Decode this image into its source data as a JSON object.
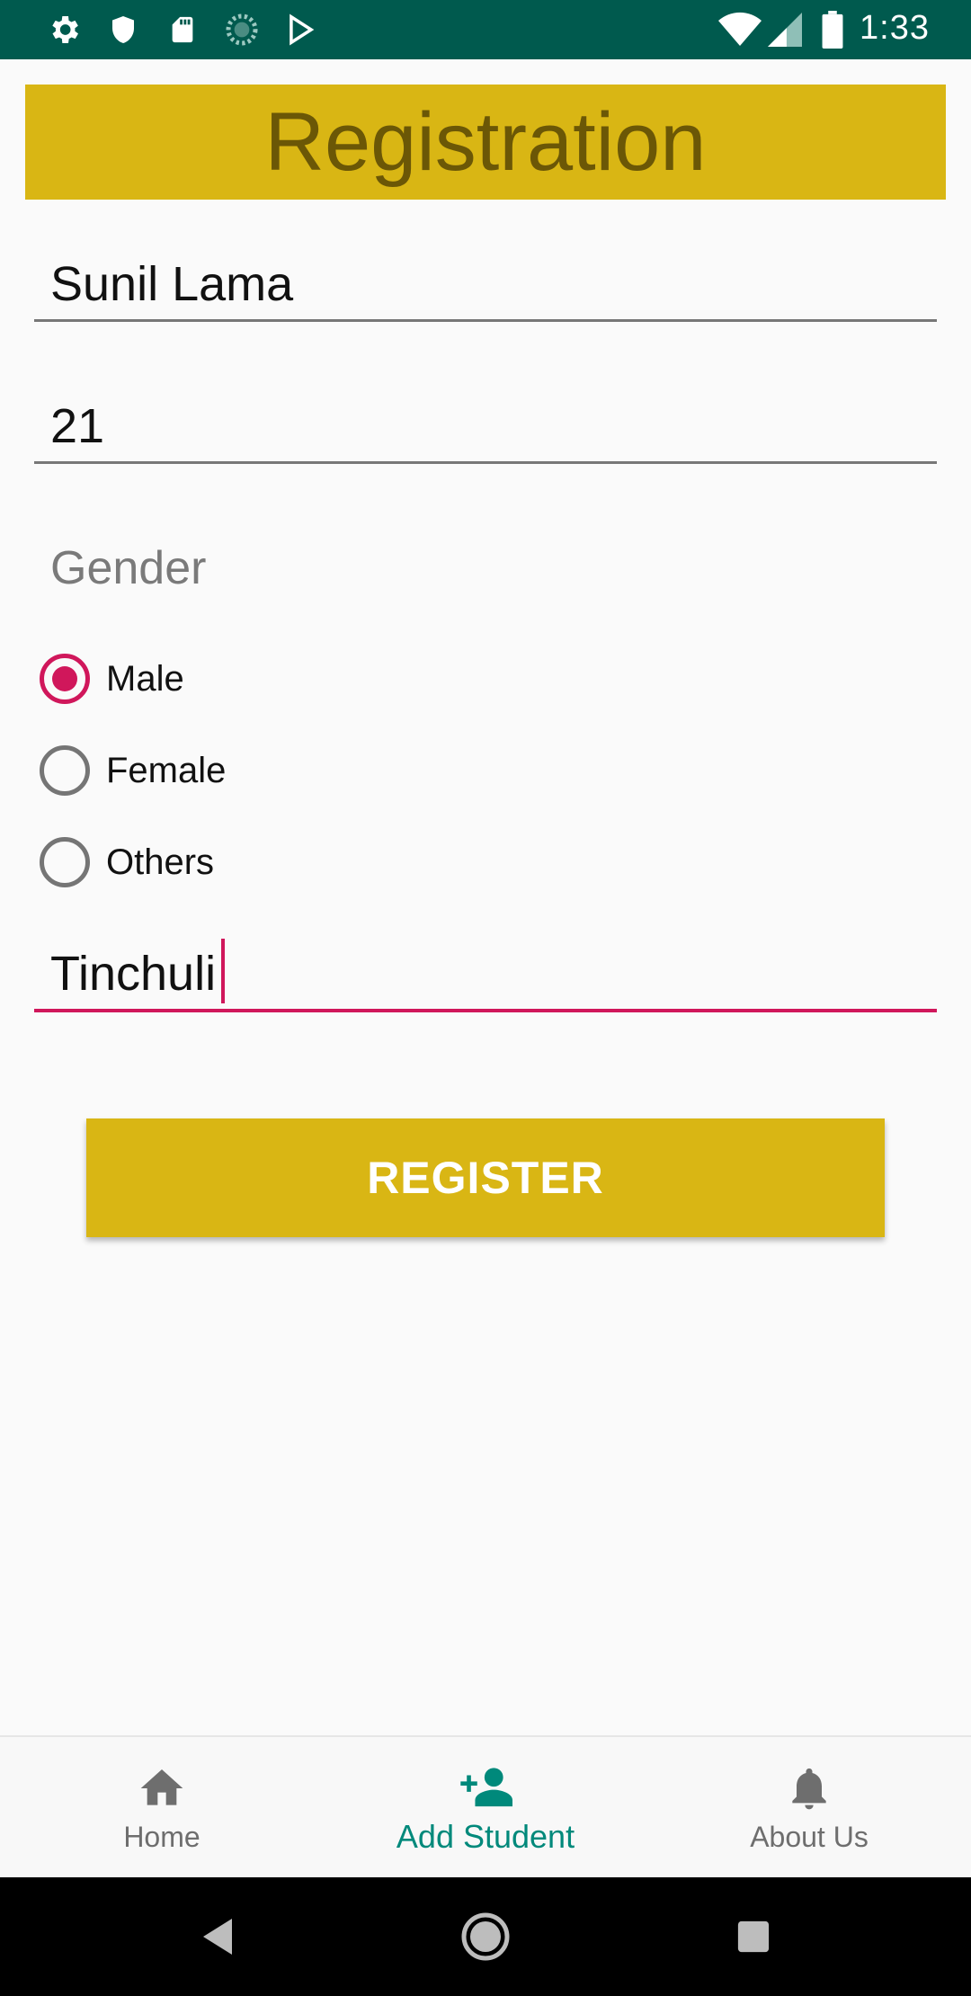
{
  "status_bar": {
    "time": "1:33",
    "icons_left": [
      "settings-icon",
      "shield-icon",
      "sd-card-icon",
      "sync-icon",
      "play-store-icon"
    ],
    "icons_right": [
      "wifi-icon",
      "signal-icon",
      "battery-icon"
    ],
    "bg_color": "#005A4E"
  },
  "header": {
    "title": "Registration",
    "bg_color": "#D9B614",
    "text_color": "#6B5706"
  },
  "form": {
    "name_value": "Sunil Lama",
    "age_value": "21",
    "gender_label": "Gender",
    "gender_options": [
      {
        "label": "Male",
        "checked": true
      },
      {
        "label": "Female",
        "checked": false
      },
      {
        "label": "Others",
        "checked": false
      }
    ],
    "address_value": "Tinchuli",
    "accent_color": "#D0175B"
  },
  "register_button": {
    "label": "REGISTER"
  },
  "bottom_nav": {
    "items": [
      {
        "label": "Home",
        "icon": "home-icon",
        "active": false
      },
      {
        "label": "Add Student",
        "icon": "add-person-icon",
        "active": true
      },
      {
        "label": "About Us",
        "icon": "bell-icon",
        "active": false
      }
    ],
    "active_color": "#00897B"
  },
  "system_nav": {
    "buttons": [
      "back-icon",
      "home-circle-icon",
      "recents-icon"
    ]
  }
}
